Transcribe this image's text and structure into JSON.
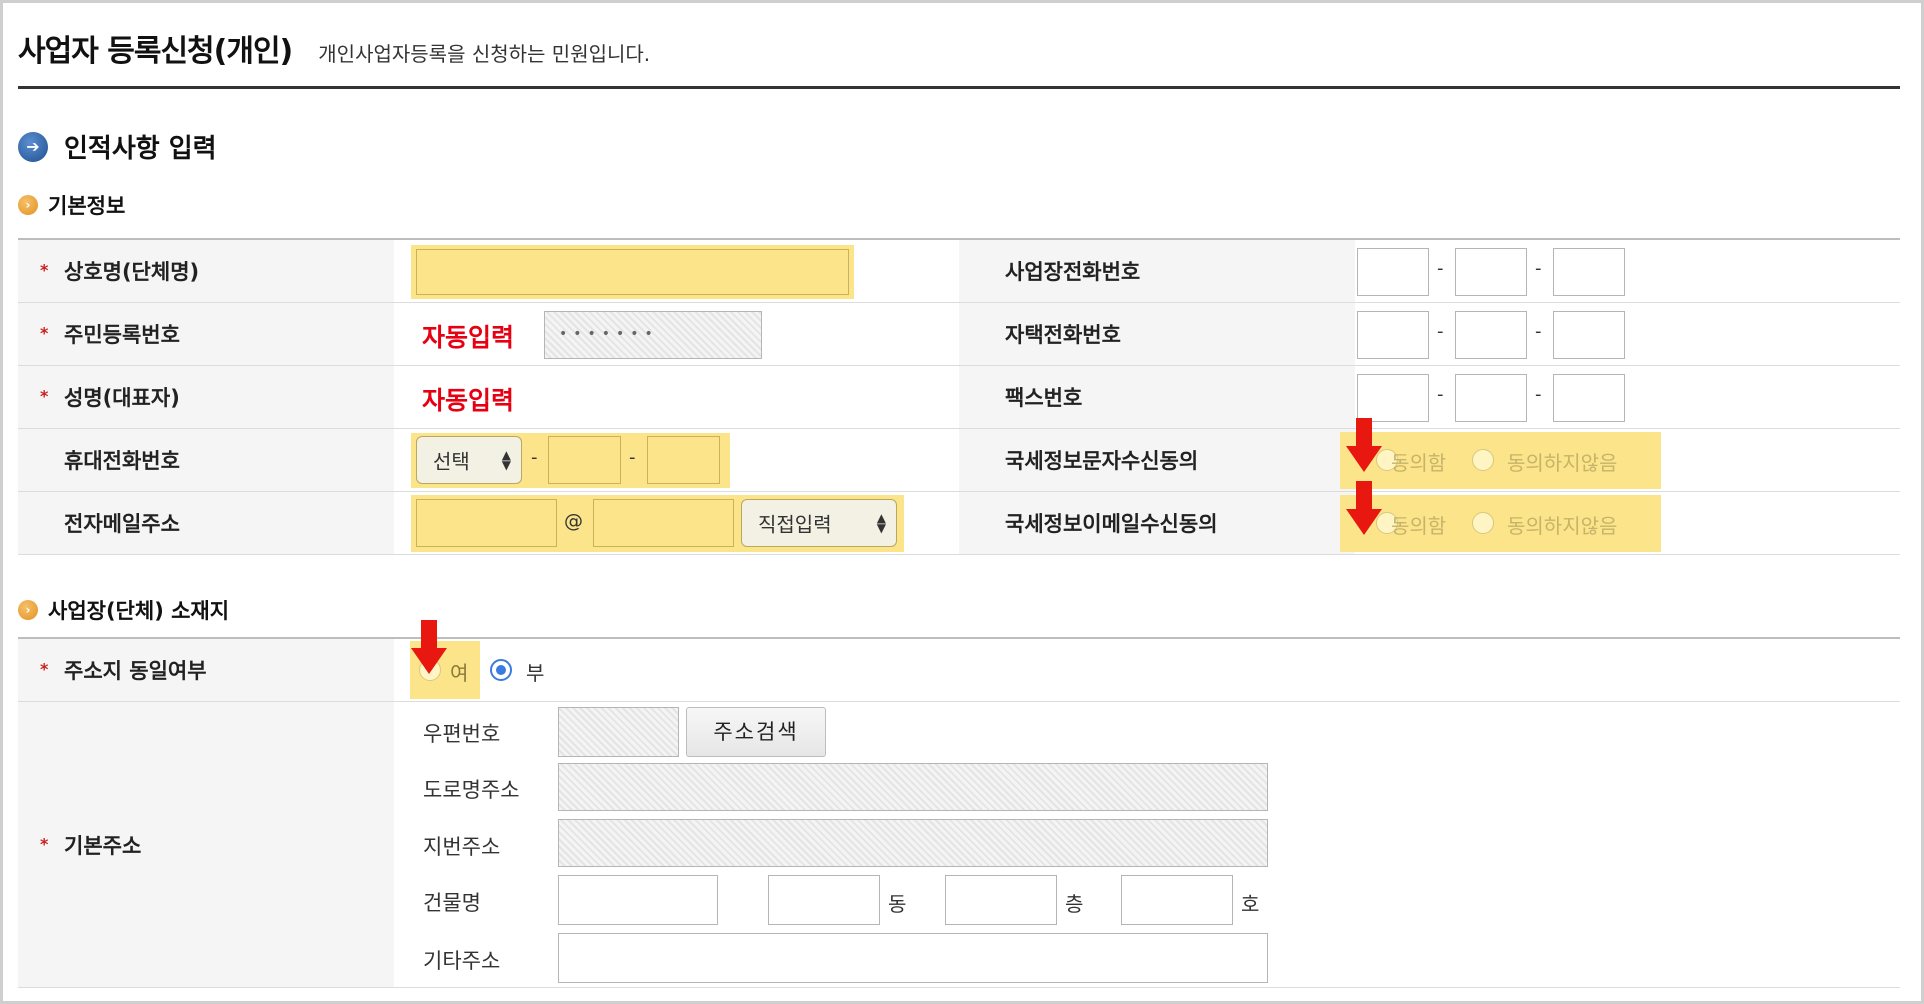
{
  "page": {
    "title": "사업자 등록신청(개인)",
    "description": "개인사업자등록을 신청하는 민원입니다."
  },
  "section": {
    "title": "인적사항 입력",
    "icon": "arrow-right-circle-icon"
  },
  "basic_info": {
    "title": "기본정보",
    "icon": "chevron-circle-icon",
    "required_mark": "*",
    "company_name_label": "상호명(단체명)",
    "resident_number_label": "주민등록번호",
    "resident_number_auto": "자동입력",
    "resident_number_masked": "•••••••",
    "name_label": "성명(대표자)",
    "name_auto": "자동입력",
    "mobile_label": "휴대전화번호",
    "mobile_select": "선택",
    "email_label": "전자메일주소",
    "email_at": "@",
    "email_domain_select": "직접입력",
    "business_phone_label": "사업장전화번호",
    "home_phone_label": "자택전화번호",
    "fax_label": "팩스번호",
    "dash": "-",
    "sms_consent_label": "국세정보문자수신동의",
    "email_consent_label": "국세정보이메일수신동의",
    "agree_label": "동의함",
    "disagree_label": "동의하지않음"
  },
  "location": {
    "title": "사업장(단체) 소재지",
    "icon": "chevron-circle-icon",
    "same_address_label": "주소지 동일여부",
    "option_yes": "여",
    "option_no": "부",
    "selected_option": "부",
    "base_address_label": "기본주소",
    "postal_code_label": "우편번호",
    "address_search_button": "주소검색",
    "road_address_label": "도로명주소",
    "lot_address_label": "지번주소",
    "building_label": "건물명",
    "dong_unit": "동",
    "floor_unit": "층",
    "ho_unit": "호",
    "other_address_label": "기타주소"
  },
  "colors": {
    "highlight": "#fbe48a",
    "auto_text": "#e60012",
    "arrow": "#e8170f",
    "radio_selected": "#3b7be0"
  }
}
